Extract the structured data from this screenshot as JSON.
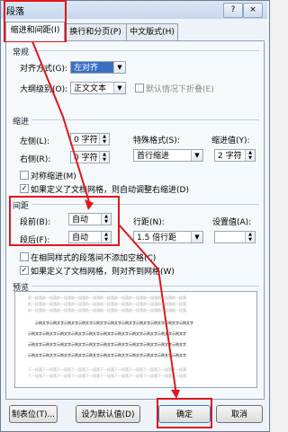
{
  "window": {
    "title": "段落",
    "help": "?",
    "close": "×"
  },
  "tabs": [
    {
      "label": "缩进和间距(I)",
      "active": true
    },
    {
      "label": "换行和分页(P)",
      "active": false
    },
    {
      "label": "中文版式(H)",
      "active": false
    }
  ],
  "general": {
    "section_label": "常规",
    "alignment_label": "对齐方式(G):",
    "alignment_value": "左对齐",
    "outline_label": "大纲级别(O):",
    "outline_value": "正文文本",
    "collapse_label": "默认情况下折叠(E)"
  },
  "indent": {
    "section_label": "缩进",
    "left_label": "左侧(L):",
    "left_value": "0 字符",
    "right_label": "右侧(R):",
    "right_value": "0 字符",
    "special_label": "特殊格式(S):",
    "special_value": "首行缩进",
    "by_label": "缩进值(Y):",
    "by_value": "2 字符",
    "mirror_label": "对称缩进(M)",
    "auto_adjust_label": "如果定义了文档网格，则自动调整右缩进(D)"
  },
  "spacing": {
    "section_label": "间距",
    "before_label": "段前(B):",
    "before_value": "自动",
    "after_label": "段后(F):",
    "after_value": "自动",
    "line_label": "行距(N):",
    "line_value": "1.5 倍行距",
    "at_label": "设置值(A):",
    "no_space_label": "在相同样式的段落间不添加空格(C)",
    "snap_grid_label": "如果定义了文档网格，则对齐到网格(W)"
  },
  "preview": {
    "section_label": "预览",
    "prev_text": "前一段落前一段落前一段落前一段落前一段落前一段落前一段落前一段落前一段落前一段落前一段落",
    "sample_text": "示例文字示例文字示例文字示例文字示例文字示例文字示例文字示例文字示例文字示例文字示例文字",
    "next_text": "下一段落下一段落下一段落下一段落下一段落下一段落下一段落下一段落下一段落下一段落下一段落"
  },
  "buttons": {
    "tabs": "制表位(T)...",
    "default": "设为默认值(D)",
    "ok": "确定",
    "cancel": "取消"
  },
  "colors": {
    "highlight": "#e0171c"
  }
}
